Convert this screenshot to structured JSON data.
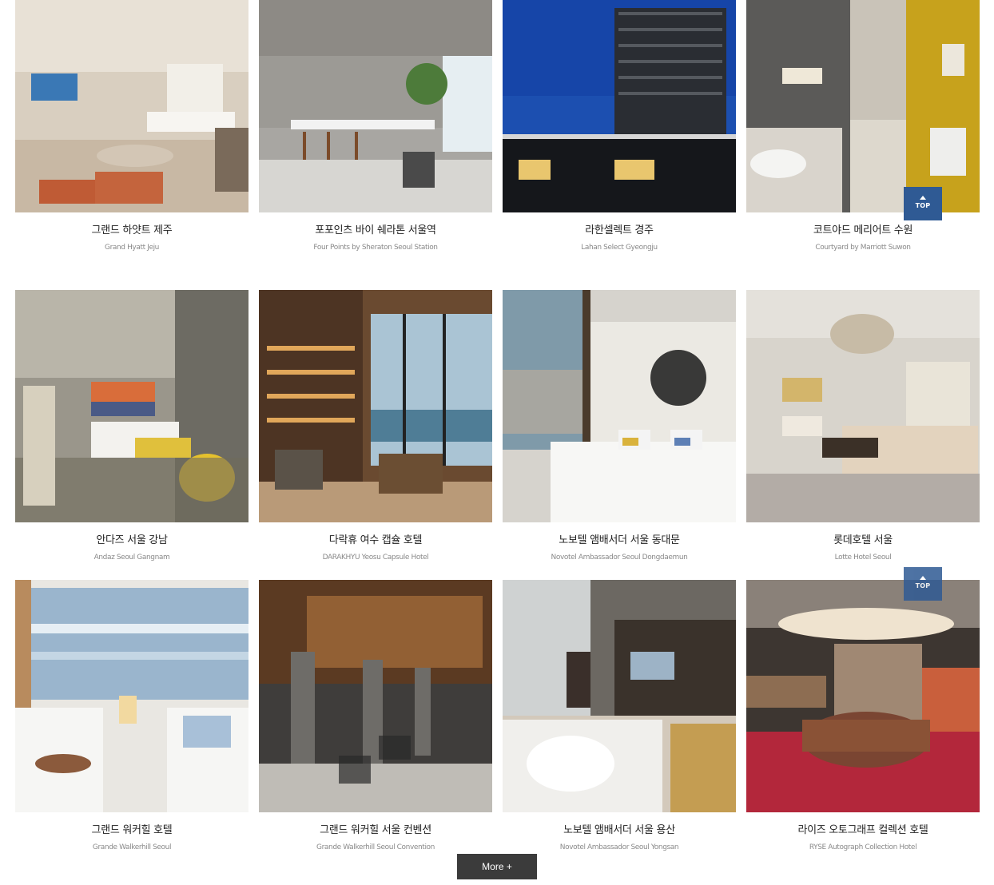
{
  "hotels": [
    {
      "name_ko": "그랜드 하얏트 제주",
      "name_en": "Grand Hyatt Jeju"
    },
    {
      "name_ko": "포포인츠 바이 쉐라톤 서울역",
      "name_en": "Four Points by Sheraton Seoul Station"
    },
    {
      "name_ko": "라한셀렉트 경주",
      "name_en": "Lahan Select Gyeongju"
    },
    {
      "name_ko": "코트야드 메리어트 수원",
      "name_en": "Courtyard by Marriott Suwon"
    },
    {
      "name_ko": "안다즈 서울 강남",
      "name_en": "Andaz Seoul Gangnam"
    },
    {
      "name_ko": "다락휴 여수 캡슐 호텔",
      "name_en": "DARAKHYU Yeosu Capsule Hotel"
    },
    {
      "name_ko": "노보텔 앰배서더 서울 동대문",
      "name_en": "Novotel Ambassador Seoul Dongdaemun"
    },
    {
      "name_ko": "롯데호텔 서울",
      "name_en": "Lotte Hotel Seoul"
    },
    {
      "name_ko": "그랜드 워커힐 호텔",
      "name_en": "Grande Walkerhill Seoul"
    },
    {
      "name_ko": "그랜드 워커힐 서울 컨벤션",
      "name_en": "Grande Walkerhill Seoul Convention"
    },
    {
      "name_ko": "노보텔 앰배서더 서울 용산",
      "name_en": "Novotel Ambassador Seoul Yongsan"
    },
    {
      "name_ko": "라이즈 오토그래프 컬렉션 호텔",
      "name_en": "RYSE Autograph Collection Hotel"
    }
  ],
  "top_button": {
    "label": "TOP"
  },
  "more_button": {
    "label": "More +"
  },
  "colors": {
    "top_button_bg": "#2f5a94",
    "more_button_bg": "#3b3b3b"
  }
}
